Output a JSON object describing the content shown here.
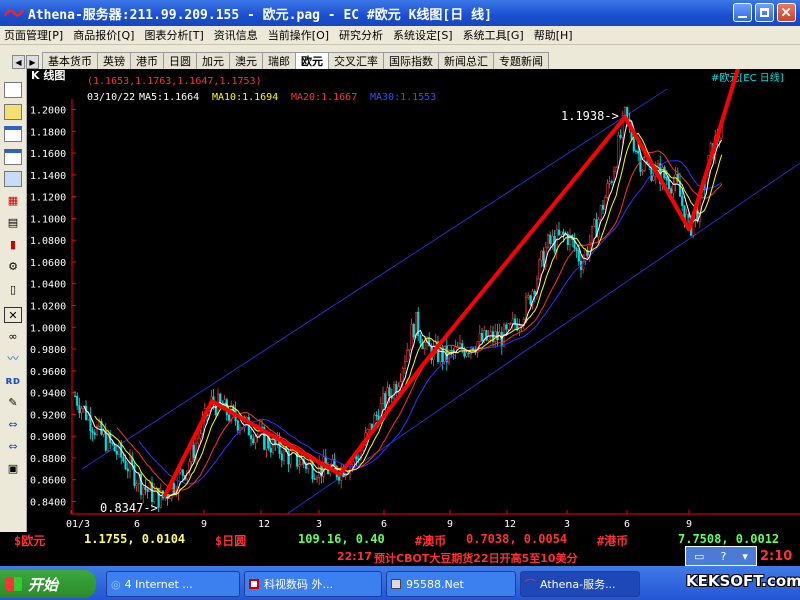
{
  "window": {
    "title": "Athena-服务器:211.99.209.155  - 欧元.pag - EC #欧元 K线图[日 线]"
  },
  "menu": [
    "页面管理[P]",
    "商品报价[Q]",
    "图表分析[T]",
    "资讯信息",
    "当前操作[O]",
    "研究分析",
    "系统设定[S]",
    "系统工具[G]",
    "帮助[H]"
  ],
  "tabs": [
    "基本货币",
    "英镑",
    "港币",
    "日圆",
    "加元",
    "澳元",
    "瑞郎",
    "欧元",
    "交叉汇率",
    "国际指数",
    "新闻总汇",
    "专题新闻"
  ],
  "active_tab": "欧元",
  "chart_header": {
    "chart_kind": "K 线图",
    "ohlc": "(1.1653,1.1763,1.1647,1.1753)",
    "date": "03/10/22",
    "ma5": "MA5:1.1664",
    "ma10": "MA10:1.1694",
    "ma20": "MA20:1.1667",
    "ma30": "MA30:1.1553",
    "symbol": "#欧元[EC 日线]"
  },
  "chart_data": {
    "type": "candlestick",
    "y_ticks": [
      "1.2000",
      "1.1800",
      "1.1600",
      "1.1400",
      "1.1200",
      "1.1000",
      "1.0800",
      "1.0600",
      "1.0400",
      "1.0200",
      "1.0000",
      "0.9800",
      "0.9600",
      "0.9400",
      "0.9200",
      "0.9000",
      "0.8800",
      "0.8600",
      "0.8400"
    ],
    "ylim": [
      0.832,
      1.212
    ],
    "x_ticks": [
      "01/3",
      "6",
      "9",
      "12",
      "3",
      "6",
      "9",
      "12",
      "3",
      "6",
      "9"
    ],
    "annotations": {
      "high": "1.1938->",
      "low": "0.8347->"
    },
    "trend_path": [
      0.844,
      0.932,
      0.865,
      0.968,
      1.193,
      1.09,
      1.265
    ],
    "colors": {
      "ma5": "#ffffff",
      "ma10": "#ffff00",
      "ma20": "#ff3030",
      "ma30": "#3030ff",
      "axis": "#ff0000",
      "overlay": "#ff0000",
      "channel": "#2030c0"
    }
  },
  "bottom": {
    "q1_name": "$欧元",
    "q1_val": "1.1755, 0.0104",
    "q2_name": "$日圆",
    "q2_val": "109.16, 0.40",
    "q3_name": "#澳币",
    "q3_val": "0.7038, 0.0054",
    "q4_name": "#港币",
    "q4_val": "7.7508, 0.0012"
  },
  "news": {
    "time": "22:17",
    "text": "预计CBOT大豆期货22日开高5至10美分",
    "clock": "2:10"
  },
  "taskbar": {
    "start": "开始",
    "items": [
      "4 Internet ...",
      "科视数码 外...",
      "95588.Net",
      "Athena-服务..."
    ]
  },
  "watermark": "KEKSOFT.com"
}
